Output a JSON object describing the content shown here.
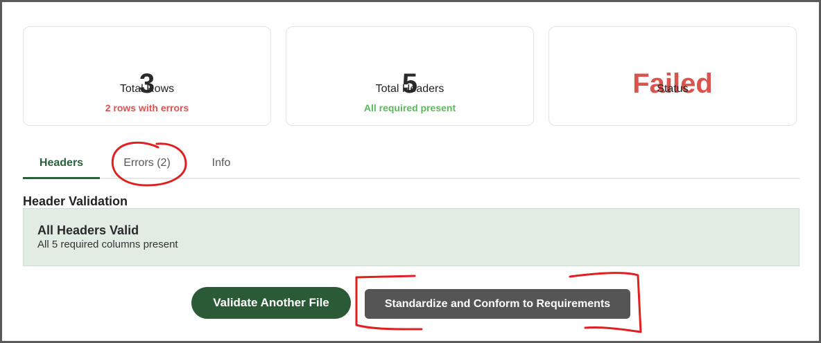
{
  "summary": {
    "rows": {
      "value": "3",
      "label": "Total Rows",
      "sub": "2 rows with errors"
    },
    "headers": {
      "value": "5",
      "label": "Total Headers",
      "sub": "All required present"
    },
    "status": {
      "value": "Failed",
      "label": "Status"
    }
  },
  "tabs": [
    {
      "label": "Headers",
      "active": true
    },
    {
      "label": "Errors (2)",
      "active": false
    },
    {
      "label": "Info",
      "active": false
    }
  ],
  "section": {
    "title": "Header Validation",
    "alert_title": "All Headers Valid",
    "alert_text": "All 5 required columns present"
  },
  "actions": {
    "validate_label": "Validate Another File",
    "standardize_label": "Standardize and Conform to Requirements"
  },
  "colors": {
    "accent_green": "#2b5a36",
    "error_red": "#d9534f",
    "success_green": "#5cb85c",
    "annotation_red": "#e02020"
  }
}
